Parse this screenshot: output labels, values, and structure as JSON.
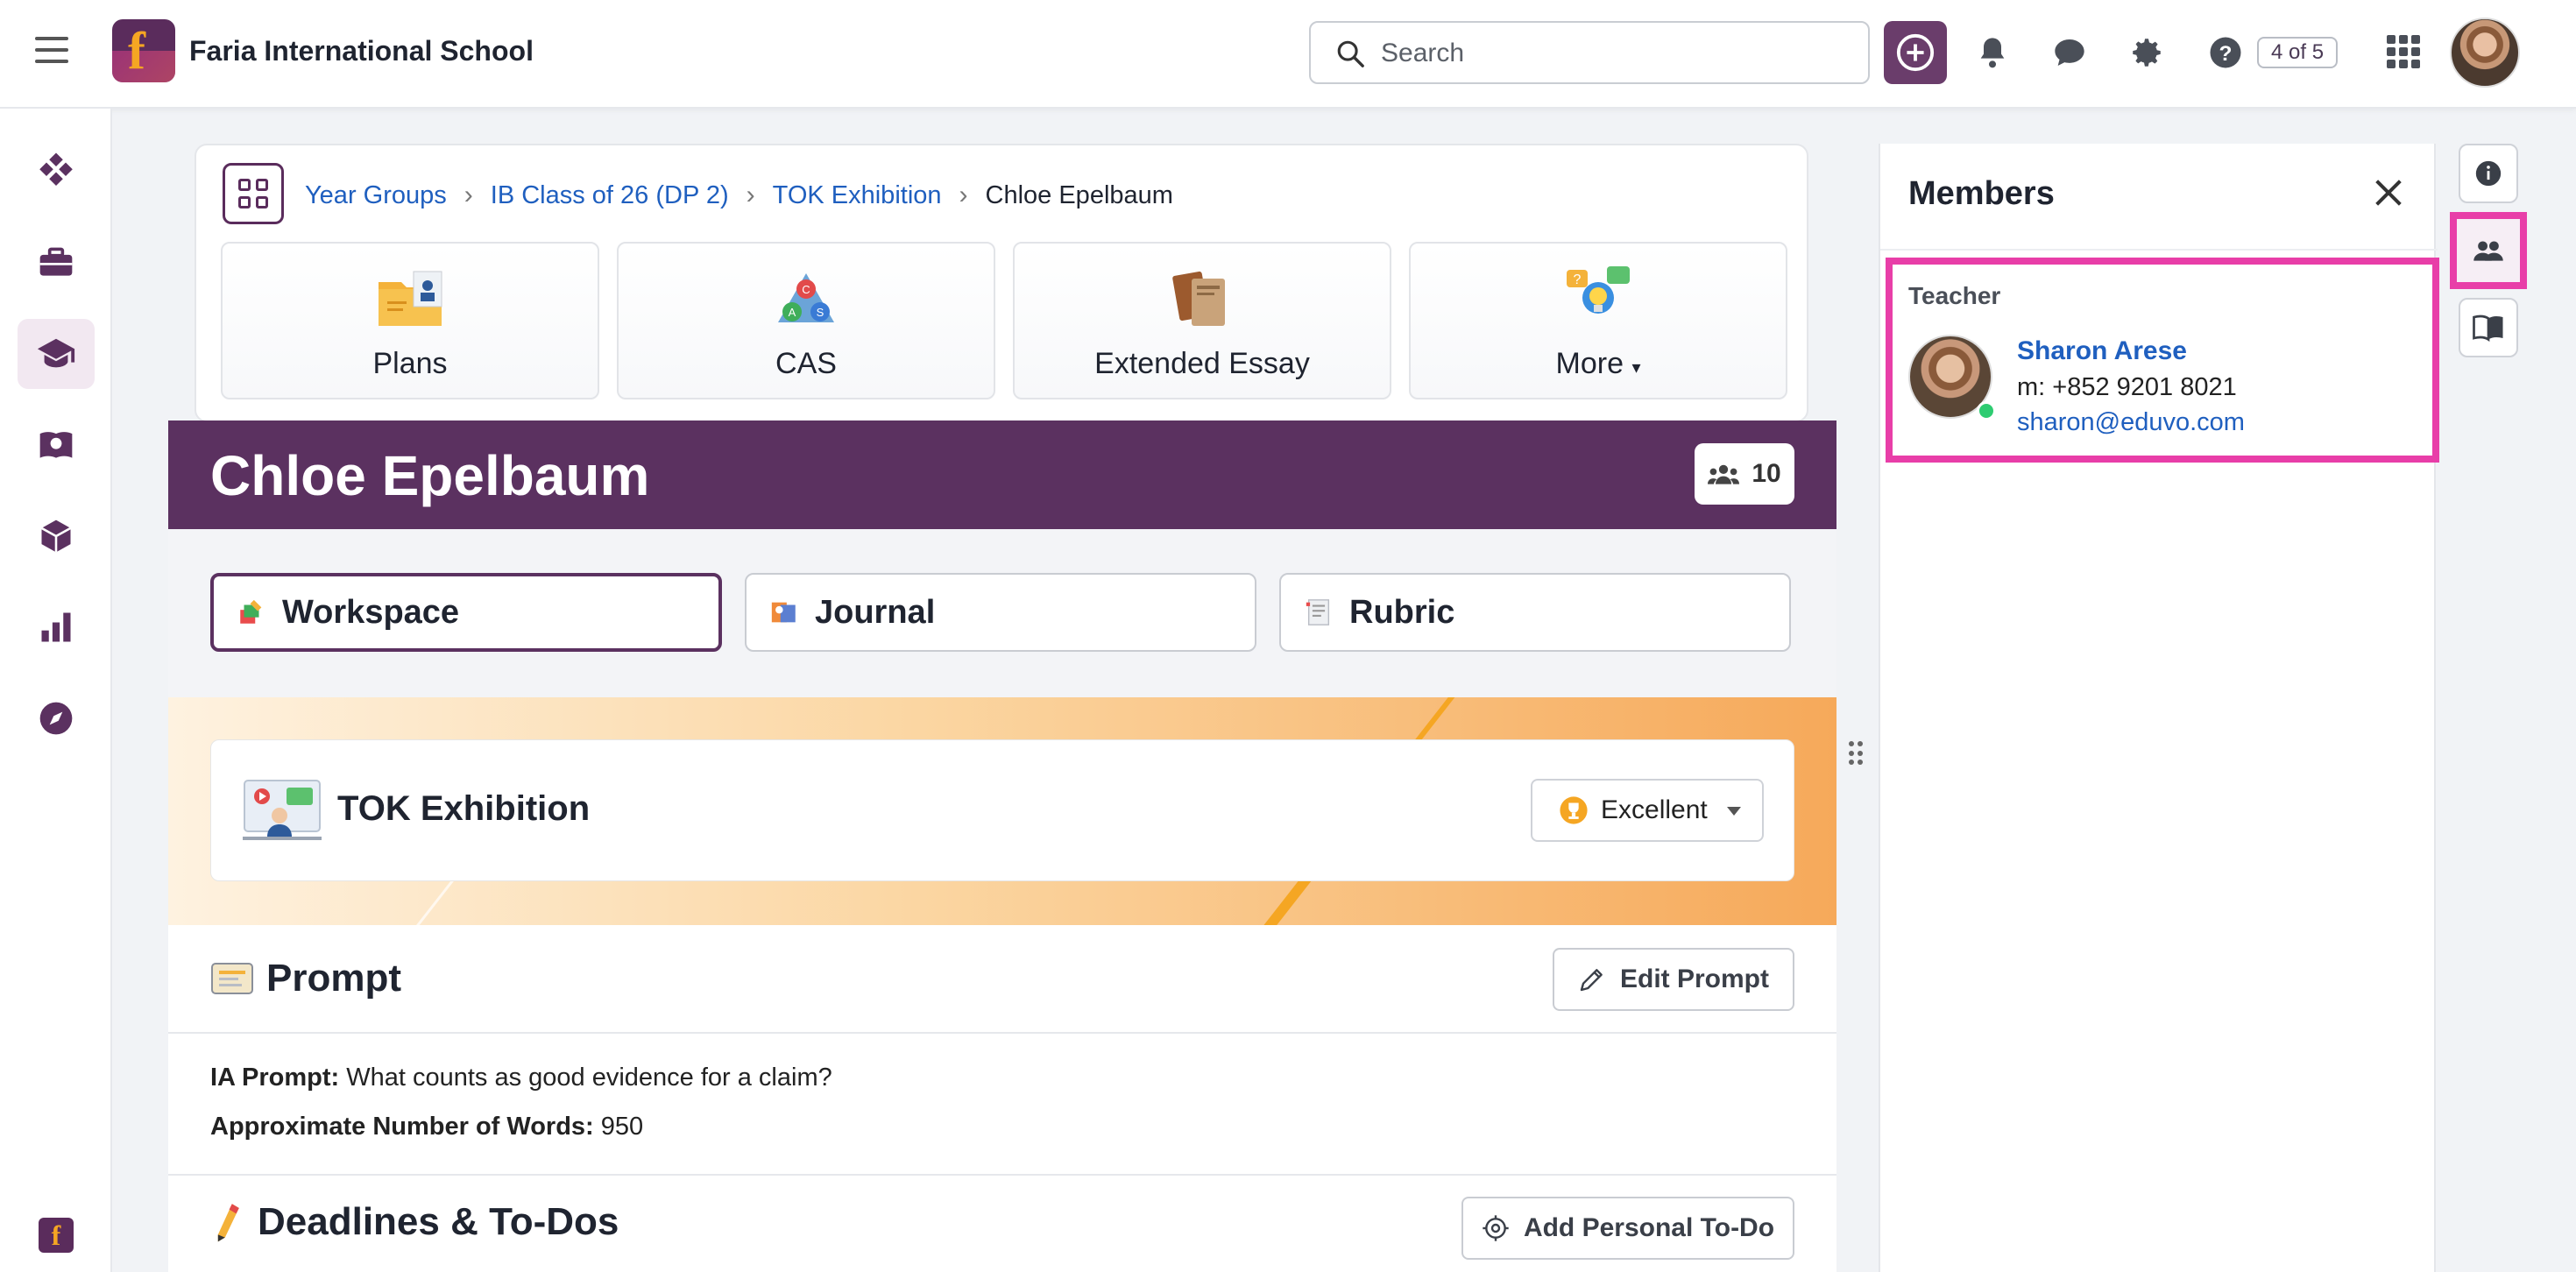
{
  "header": {
    "school_name": "Faria International School",
    "search_placeholder": "Search",
    "help_badge": "4 of 5",
    "icons": [
      "menu-icon",
      "add-icon",
      "bell-icon",
      "chat-icon",
      "gear-icon",
      "help-icon",
      "apps-grid-icon"
    ]
  },
  "sidebar": {
    "items": [
      {
        "icon": "dashboard-icon"
      },
      {
        "icon": "briefcase-icon"
      },
      {
        "icon": "graduation-cap-icon",
        "active": true
      },
      {
        "icon": "atlas-book-icon"
      },
      {
        "icon": "cube-icon"
      },
      {
        "icon": "bar-chart-icon"
      },
      {
        "icon": "compass-icon"
      }
    ]
  },
  "breadcrumb": {
    "items": [
      "Year Groups",
      "IB Class of 26 (DP 2)",
      "TOK Exhibition"
    ],
    "current": "Chloe Epelbaum"
  },
  "tiles": [
    {
      "label": "Plans"
    },
    {
      "label": "CAS"
    },
    {
      "label": "Extended Essay"
    },
    {
      "label": "More"
    }
  ],
  "student": {
    "name": "Chloe Epelbaum",
    "members_count": "10"
  },
  "tabs": [
    {
      "label": "Workspace",
      "active": true
    },
    {
      "label": "Journal"
    },
    {
      "label": "Rubric"
    }
  ],
  "assessment": {
    "title": "TOK Exhibition",
    "grade": "Excellent"
  },
  "prompt": {
    "heading": "Prompt",
    "edit_label": "Edit Prompt",
    "ia_label": "IA Prompt:",
    "ia_value": "What counts as good evidence for a claim?",
    "words_label": "Approximate Number of Words:",
    "words_value": "950"
  },
  "deadlines": {
    "heading": "Deadlines & To-Dos",
    "add_label": "Add Personal To-Do"
  },
  "members_panel": {
    "title": "Members",
    "role": "Teacher",
    "teacher_name": "Sharon Arese",
    "phone": "m: +852 9201 8021",
    "email": "sharon@eduvo.com"
  },
  "colors": {
    "brand": "#5b3160",
    "highlight": "#e83ea8",
    "link": "#1f5fbf"
  }
}
